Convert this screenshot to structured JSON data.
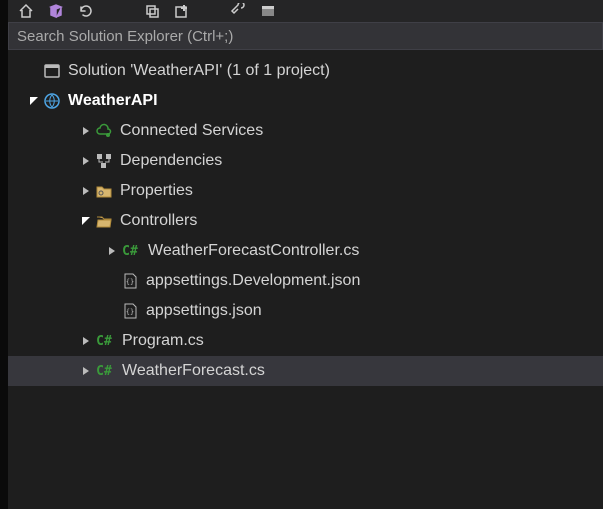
{
  "search": {
    "placeholder": "Search Solution Explorer (Ctrl+;)"
  },
  "icons": {
    "cs_badge": "C#"
  },
  "tree": {
    "solution": "Solution 'WeatherAPI' (1 of 1 project)",
    "project": "WeatherAPI",
    "connected_services": "Connected Services",
    "dependencies": "Dependencies",
    "properties": "Properties",
    "controllers": "Controllers",
    "weather_controller": "WeatherForecastController.cs",
    "appsettings_dev": "appsettings.Development.json",
    "appsettings": "appsettings.json",
    "program": "Program.cs",
    "weather_forecast": "WeatherForecast.cs"
  }
}
